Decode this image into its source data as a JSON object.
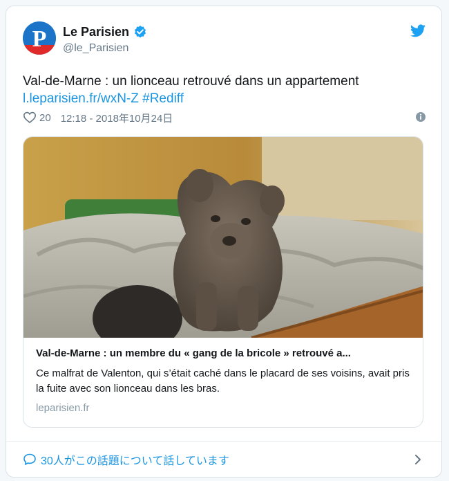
{
  "colors": {
    "accent": "#1b95e0",
    "secondary_text": "#657786",
    "verified": "#1da1f2",
    "border": "#d9e1e8"
  },
  "header": {
    "avatar_letter": "P",
    "display_name": "Le Parisien",
    "handle": "@le_Parisien",
    "verified_icon": "verified-badge-icon",
    "brand_icon": "twitter-bird-icon"
  },
  "tweet": {
    "text": "Val-de-Marne : un lionceau retrouvé dans un appartement",
    "link": "l.leparisien.fr/wxN-Z #Rediff"
  },
  "meta": {
    "like_count": "20",
    "timestamp": "12:18 - 2018年10月24日"
  },
  "link_card": {
    "image_description": "lion-cub-on-bed-photo",
    "title": "Val-de-Marne : un membre du « gang de la bricole » retrouvé a...",
    "description": "Ce malfrat de Valenton, qui s’était caché dans le placard de ses voisins, avait pris la fuite avec son lionceau dans les bras.",
    "domain": "leparisien.fr"
  },
  "footer": {
    "conversation_text": "30人がこの話題について話しています"
  }
}
